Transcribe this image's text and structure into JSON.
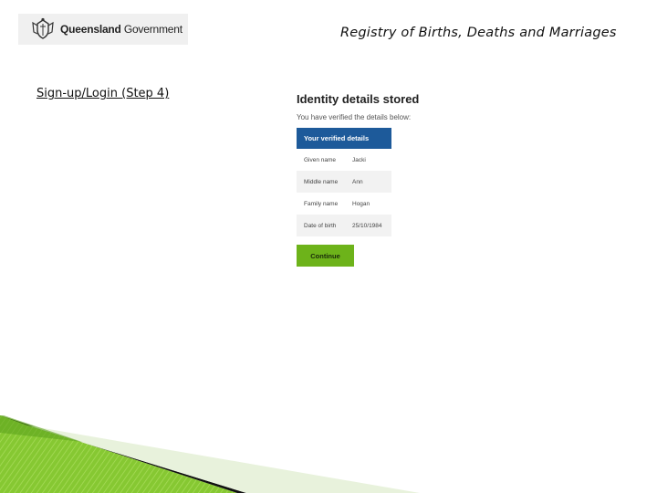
{
  "header": {
    "logo_brand": "Queensland",
    "logo_suffix": "Government",
    "registry_title": "Registry of Births, Deaths and Marriages"
  },
  "step_link": "Sign-up/Login (Step 4)",
  "identity": {
    "title": "Identity details stored",
    "subtitle": "You have verified the details below:",
    "card_header": "Your verified details",
    "rows": [
      {
        "label": "Given name",
        "value": "Jacki"
      },
      {
        "label": "Middle name",
        "value": "Ann"
      },
      {
        "label": "Family name",
        "value": "Hogan"
      },
      {
        "label": "Date of birth",
        "value": "25/10/1984"
      }
    ],
    "continue_label": "Continue"
  },
  "colors": {
    "card_header_bg": "#1d5a9a",
    "continue_bg": "#6db31a",
    "decor_green": "#7cc42a"
  }
}
